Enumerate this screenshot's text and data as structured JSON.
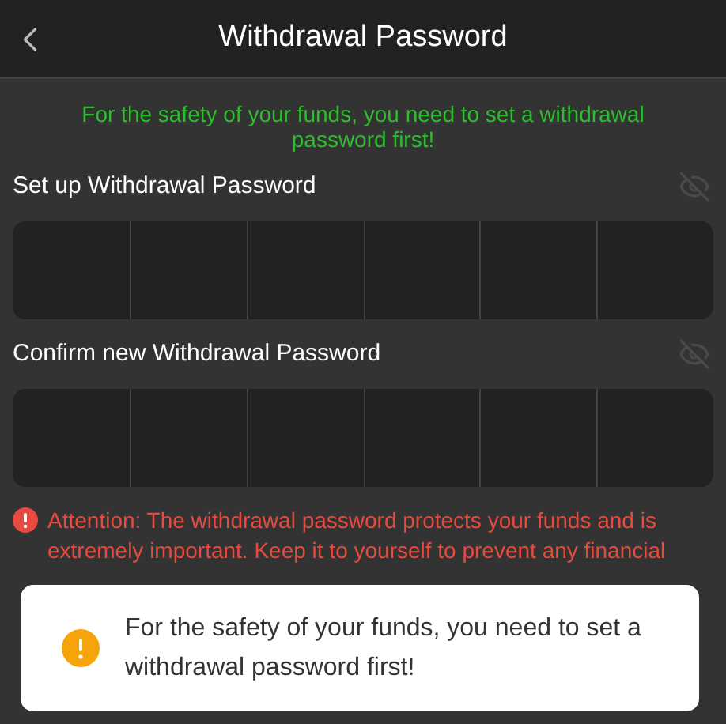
{
  "header": {
    "title": "Withdrawal Password"
  },
  "notice": "For the safety of your funds, you need to set a withdrawal password first!",
  "fields": [
    {
      "label": "Set up Withdrawal Password",
      "password_visible": false
    },
    {
      "label": "Confirm new Withdrawal Password",
      "password_visible": false
    }
  ],
  "attention": "Attention: The withdrawal password protects your funds and is extremely important. Keep it to yourself to prevent any financial",
  "toast": {
    "message": "For the safety of your funds, you need to set a withdrawal password first!"
  }
}
